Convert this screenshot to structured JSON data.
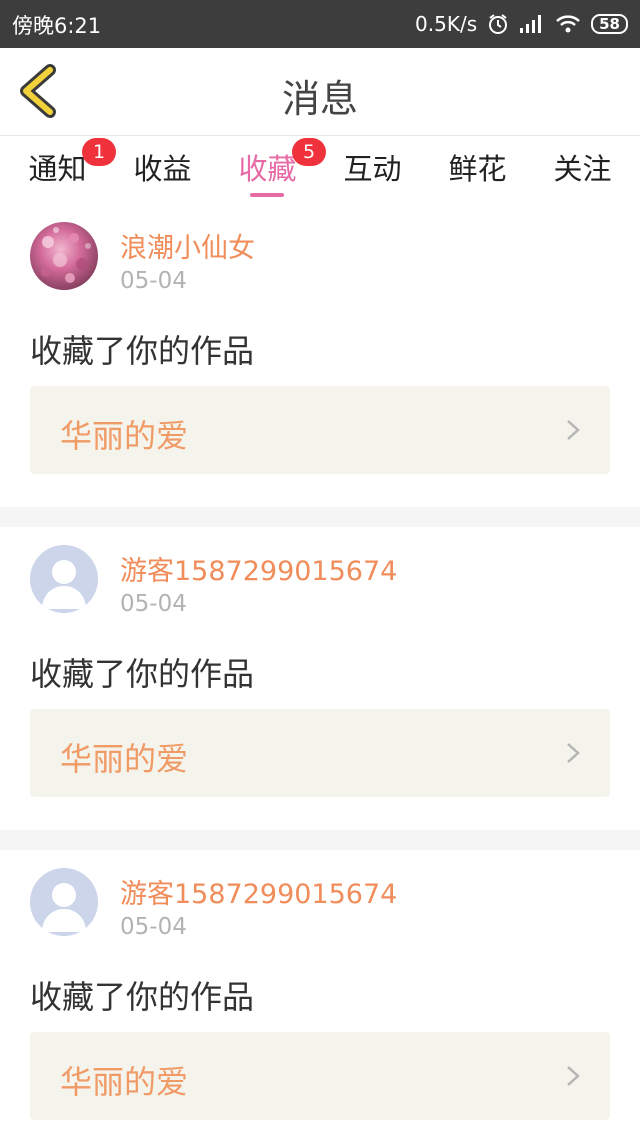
{
  "status_bar": {
    "time": "傍晚6:21",
    "network_speed": "0.5K/s",
    "battery": "58"
  },
  "header": {
    "title": "消息"
  },
  "tabs": [
    {
      "label": "通知",
      "badge": "1"
    },
    {
      "label": "收益",
      "badge": null
    },
    {
      "label": "收藏",
      "badge": "5",
      "active": true
    },
    {
      "label": "互动",
      "badge": null
    },
    {
      "label": "鲜花",
      "badge": null
    },
    {
      "label": "关注",
      "badge": null
    }
  ],
  "feed": [
    {
      "user_name": "浪潮小仙女",
      "date": "05-04",
      "action": "收藏了你的作品",
      "work_title": "华丽的爱",
      "avatar": "flower-photo-avatar"
    },
    {
      "user_name": "游客1587299015674",
      "date": "05-04",
      "action": "收藏了你的作品",
      "work_title": "华丽的爱",
      "avatar": "default-user-avatar"
    },
    {
      "user_name": "游客1587299015674",
      "date": "05-04",
      "action": "收藏了你的作品",
      "work_title": "华丽的爱",
      "avatar": "default-user-avatar"
    }
  ],
  "colors": {
    "accent": "#e66aa6",
    "user_name": "#f08d5b",
    "work_title": "#f09a66",
    "badge": "#f0323c",
    "back_icon": "#f2d23a"
  }
}
